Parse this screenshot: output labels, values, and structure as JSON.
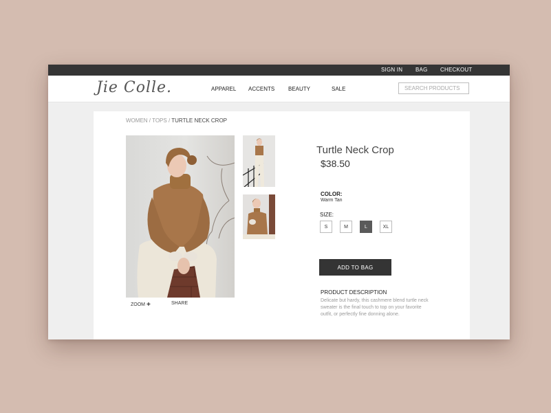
{
  "topbar": {
    "sign_in": "SIGN IN",
    "bag": "BAG",
    "checkout": "CHECKOUT"
  },
  "header": {
    "logo": "Jie Colle.",
    "nav": [
      "APPAREL",
      "ACCENTS",
      "BEAUTY",
      "SALE"
    ],
    "search_placeholder": "SEARCH PRODUCTS"
  },
  "breadcrumb": {
    "women": "WOMEN",
    "sep1": " / ",
    "tops": "TOPS",
    "sep2": " / ",
    "current": "TURTLE NECK CROP"
  },
  "gallery": {
    "zoom": "ZOOM",
    "zoom_icon": "plus-icon",
    "share": "SHARE"
  },
  "product": {
    "title": "Turtle Neck Crop",
    "price": "$38.50",
    "color_label": "COLOR:",
    "color_value": "Warm Tan",
    "size_label": "SIZE:",
    "sizes": [
      "S",
      "M",
      "L",
      "XL"
    ],
    "selected_size": "L",
    "add_to_bag": "ADD TO BAG",
    "description_heading": "PRODUCT DESCRIPTION",
    "description": "Delicate but hardy, this cashmere blend turtle neck sweater is the final touch to top on your favorite outfit, or perfectly fine donning alone."
  },
  "colors": {
    "topbar": "#353535",
    "background": "#d4bcb0",
    "sweater": "#a8764a",
    "button": "#343434",
    "selected_size": "#5a5a5a"
  }
}
